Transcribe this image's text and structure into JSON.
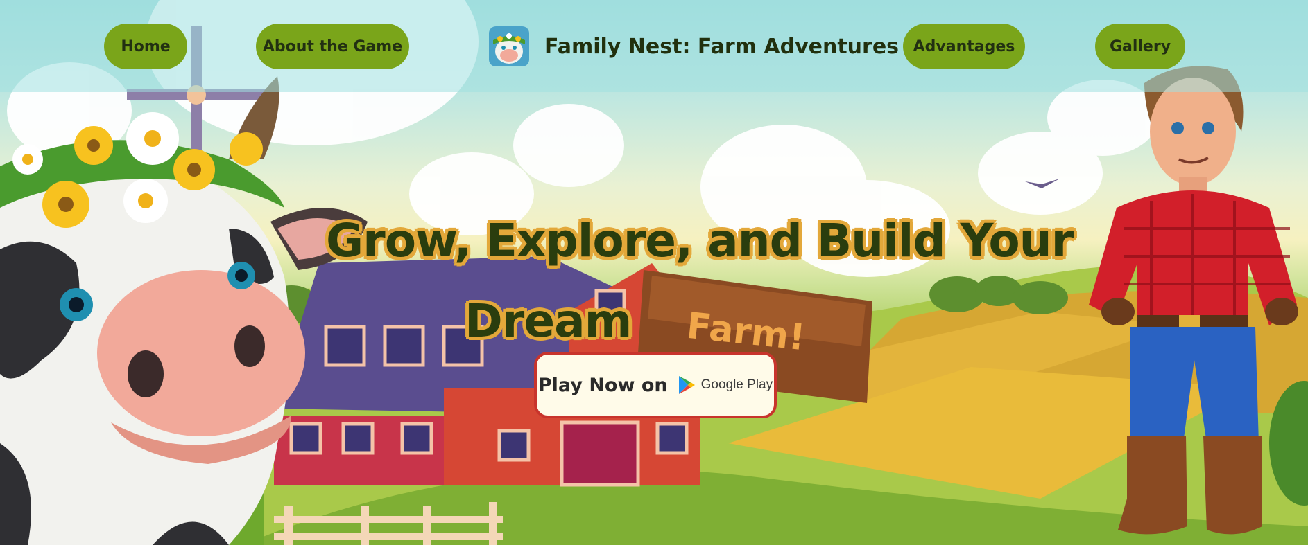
{
  "nav": {
    "left_items": [
      {
        "label": "Home"
      },
      {
        "label": "About the Game"
      }
    ],
    "right_items": [
      {
        "label": "Advantages"
      },
      {
        "label": "Gallery"
      }
    ],
    "brand_title": "Family Nest: Farm Adventures"
  },
  "hero": {
    "headline_line1": "Grow, Explore, and Build Your",
    "headline_line2": "Dream",
    "sign_text": "Farm!",
    "play_label": "Play Now on",
    "store_label": "Google Play"
  },
  "colors": {
    "nav_pill": "#7aa51a",
    "headline_text": "#2a3d0e",
    "headline_outline": "#e3a83a",
    "play_border": "#c8342c"
  },
  "icons": {
    "brand": "cow-game-logo-icon",
    "store": "google-play-icon"
  }
}
